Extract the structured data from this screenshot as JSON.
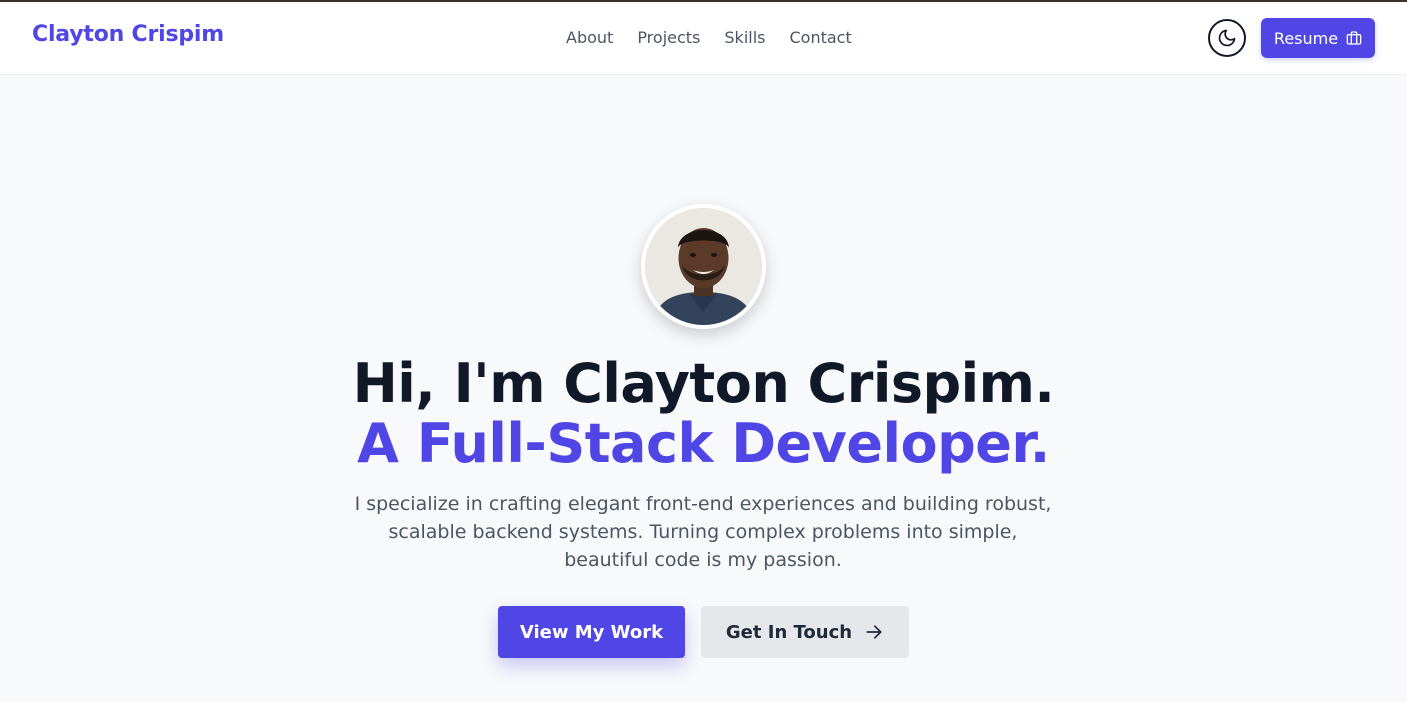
{
  "header": {
    "brand": "Clayton Crispim",
    "nav": [
      {
        "label": "About"
      },
      {
        "label": "Projects"
      },
      {
        "label": "Skills"
      },
      {
        "label": "Contact"
      }
    ],
    "theme_toggle_icon": "moon-icon",
    "resume_label": "Resume",
    "resume_icon": "briefcase-icon"
  },
  "hero": {
    "avatar_icon": "profile-photo",
    "title_line1": "Hi, I'm Clayton Crispim.",
    "title_line2": "A Full-Stack Developer.",
    "intro": "I specialize in crafting elegant front-end experiences and building robust, scalable backend systems. Turning complex problems into simple, beautiful code is my passion.",
    "primary_cta": "View My Work",
    "secondary_cta": "Get In Touch",
    "secondary_icon": "arrow-right-icon"
  },
  "colors": {
    "accent": "#4f46e5",
    "heading": "#111827",
    "body_text": "#4b5563",
    "background": "#f8f9fb"
  }
}
